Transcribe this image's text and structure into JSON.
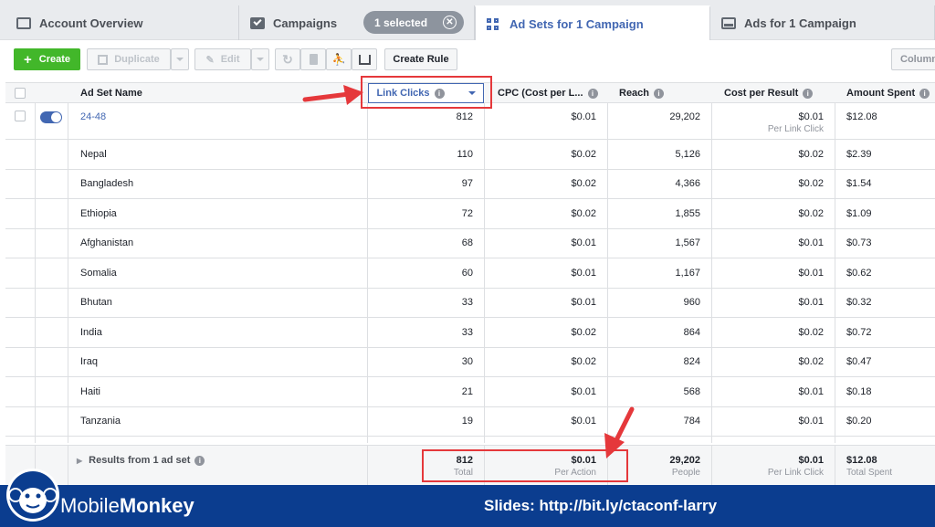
{
  "tabs": {
    "account": "Account Overview",
    "campaigns": "Campaigns",
    "selected_pill": "1 selected",
    "adsets": "Ad Sets for 1 Campaign",
    "ads": "Ads for 1 Campaign"
  },
  "toolbar": {
    "create": "Create",
    "duplicate": "Duplicate",
    "edit": "Edit",
    "create_rule": "Create Rule",
    "columns": "Column"
  },
  "headers": {
    "name": "Ad Set Name",
    "link_clicks": "Link Clicks",
    "cpc": "CPC (Cost per L...",
    "reach": "Reach",
    "cost_per_result": "Cost per Result",
    "amount_spent": "Amount Spent"
  },
  "main_row": {
    "name": "24-48",
    "link_clicks": "812",
    "cpc": "$0.01",
    "reach": "29,202",
    "cost_per_result": "$0.01",
    "cost_per_result_sub": "Per Link Click",
    "amount_spent": "$12.08"
  },
  "rows": [
    {
      "name": "Nepal",
      "link_clicks": "110",
      "cpc": "$0.02",
      "reach": "5,126",
      "cost_per_result": "$0.02",
      "amount_spent": "$2.39"
    },
    {
      "name": "Bangladesh",
      "link_clicks": "97",
      "cpc": "$0.02",
      "reach": "4,366",
      "cost_per_result": "$0.02",
      "amount_spent": "$1.54"
    },
    {
      "name": "Ethiopia",
      "link_clicks": "72",
      "cpc": "$0.02",
      "reach": "1,855",
      "cost_per_result": "$0.02",
      "amount_spent": "$1.09"
    },
    {
      "name": "Afghanistan",
      "link_clicks": "68",
      "cpc": "$0.01",
      "reach": "1,567",
      "cost_per_result": "$0.01",
      "amount_spent": "$0.73"
    },
    {
      "name": "Somalia",
      "link_clicks": "60",
      "cpc": "$0.01",
      "reach": "1,167",
      "cost_per_result": "$0.01",
      "amount_spent": "$0.62"
    },
    {
      "name": "Bhutan",
      "link_clicks": "33",
      "cpc": "$0.01",
      "reach": "960",
      "cost_per_result": "$0.01",
      "amount_spent": "$0.32"
    },
    {
      "name": "India",
      "link_clicks": "33",
      "cpc": "$0.02",
      "reach": "864",
      "cost_per_result": "$0.02",
      "amount_spent": "$0.72"
    },
    {
      "name": "Iraq",
      "link_clicks": "30",
      "cpc": "$0.02",
      "reach": "824",
      "cost_per_result": "$0.02",
      "amount_spent": "$0.47"
    },
    {
      "name": "Haiti",
      "link_clicks": "21",
      "cpc": "$0.01",
      "reach": "568",
      "cost_per_result": "$0.01",
      "amount_spent": "$0.18"
    },
    {
      "name": "Tanzania",
      "link_clicks": "19",
      "cpc": "$0.01",
      "reach": "784",
      "cost_per_result": "$0.01",
      "amount_spent": "$0.20"
    }
  ],
  "footer": {
    "label": "Results from 1 ad set",
    "link_clicks": "812",
    "link_clicks_sub": "Total",
    "cpc": "$0.01",
    "cpc_sub": "Per Action",
    "reach": "29,202",
    "reach_sub": "People",
    "cost_per_result": "$0.01",
    "cost_per_result_sub": "Per Link Click",
    "amount_spent": "$12.08",
    "amount_spent_sub": "Total Spent"
  },
  "banner": {
    "brand_part1": "Mobile",
    "brand_part2": "Monkey",
    "slides": "Slides: http://bit.ly/ctaconf-larry"
  },
  "colors": {
    "accent": "#4267b2",
    "create_green": "#42b72a",
    "highlight_red": "#e5383b",
    "banner_blue": "#0b3d8f"
  }
}
